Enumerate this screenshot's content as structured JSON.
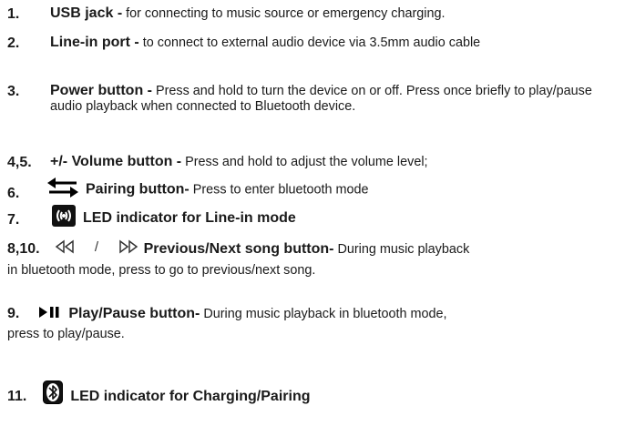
{
  "items": [
    {
      "num": "1.",
      "title": "USB jack -",
      "desc": " for connecting to music source or emergency charging."
    },
    {
      "num": "2.",
      "title": "Line-in port -",
      "desc": " to connect to external audio device via 3.5mm audio cable"
    },
    {
      "num": "3.",
      "title": "Power button -",
      "desc": " Press and hold to turn the device on or off. Press once briefly to play/pause audio playback when connected to Bluetooth device."
    },
    {
      "num": "4,5.",
      "title": "+/- Volume button -",
      "desc": " Press and hold to adjust the volume level;"
    },
    {
      "num": "6.",
      "icon": "pairing-arrows-icon",
      "title": "Pairing button-",
      "desc": " Press to enter bluetooth mode"
    },
    {
      "num": "7.",
      "icon": "line-in-led-icon",
      "title": "LED indicator for Line-in mode",
      "desc": ""
    },
    {
      "num": "8,10.",
      "icon": "prev-next-icon",
      "separator": "/",
      "title": "Previous/Next song button-",
      "desc": " During music playback",
      "cont": "in bluetooth mode, press to go to previous/next song."
    },
    {
      "num": "9.",
      "icon": "play-pause-icon",
      "title": "Play/Pause button-",
      "desc": " During music playback in bluetooth mode,",
      "cont": "press to play/pause."
    },
    {
      "num": "11.",
      "icon": "bluetooth-led-icon",
      "title": "LED indicator for Charging/Pairing",
      "desc": ""
    }
  ]
}
